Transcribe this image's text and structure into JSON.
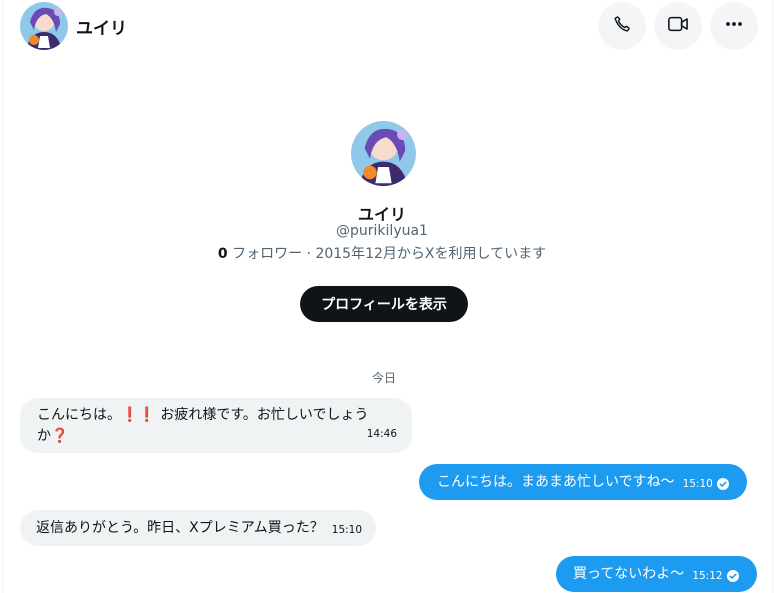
{
  "header": {
    "name": "ユイリ"
  },
  "profile": {
    "name": "ユイリ",
    "handle": "@purikilyua1",
    "followers_count": "0",
    "followers_label": "フォロワー · 2015年12月からXを利用しています",
    "view_profile_label": "プロフィールを表示"
  },
  "day_separator": "今日",
  "messages": [
    {
      "direction": "incoming",
      "text_part1": "こんにちは。",
      "text_emoji": "❗❗",
      "text_part2": " お疲れ様です。お忙しいでしょう",
      "text_part3": "か",
      "text_emoji2": "❓",
      "time": "14:46"
    },
    {
      "direction": "outgoing",
      "text": "こんにちは。まあまあ忙しいですね〜",
      "time": "15:10"
    },
    {
      "direction": "incoming",
      "text": "返信ありがとう。昨日、Xプレミアム買った？",
      "time": "15:10"
    },
    {
      "direction": "outgoing",
      "text": "買ってないわよ〜",
      "time": "15:12"
    }
  ],
  "colors": {
    "accent": "#1d9bf0",
    "incoming_bubble": "#eff3f4",
    "dark_button": "#0f1419",
    "secondary_text": "#536471"
  }
}
